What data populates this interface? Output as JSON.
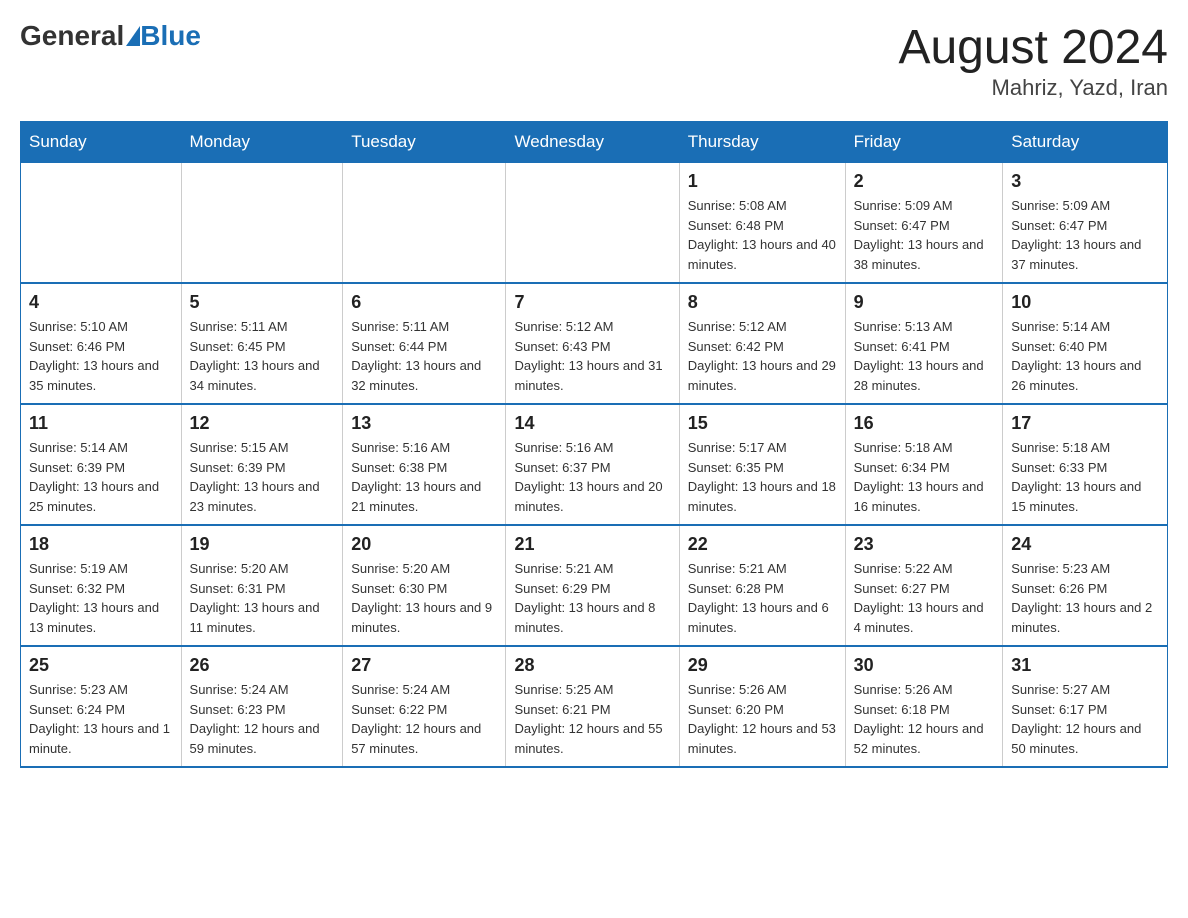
{
  "header": {
    "logo_general": "General",
    "logo_blue": "Blue",
    "month_year": "August 2024",
    "location": "Mahriz, Yazd, Iran"
  },
  "days_of_week": [
    "Sunday",
    "Monday",
    "Tuesday",
    "Wednesday",
    "Thursday",
    "Friday",
    "Saturday"
  ],
  "weeks": [
    [
      {
        "day": "",
        "info": ""
      },
      {
        "day": "",
        "info": ""
      },
      {
        "day": "",
        "info": ""
      },
      {
        "day": "",
        "info": ""
      },
      {
        "day": "1",
        "info": "Sunrise: 5:08 AM\nSunset: 6:48 PM\nDaylight: 13 hours and 40 minutes."
      },
      {
        "day": "2",
        "info": "Sunrise: 5:09 AM\nSunset: 6:47 PM\nDaylight: 13 hours and 38 minutes."
      },
      {
        "day": "3",
        "info": "Sunrise: 5:09 AM\nSunset: 6:47 PM\nDaylight: 13 hours and 37 minutes."
      }
    ],
    [
      {
        "day": "4",
        "info": "Sunrise: 5:10 AM\nSunset: 6:46 PM\nDaylight: 13 hours and 35 minutes."
      },
      {
        "day": "5",
        "info": "Sunrise: 5:11 AM\nSunset: 6:45 PM\nDaylight: 13 hours and 34 minutes."
      },
      {
        "day": "6",
        "info": "Sunrise: 5:11 AM\nSunset: 6:44 PM\nDaylight: 13 hours and 32 minutes."
      },
      {
        "day": "7",
        "info": "Sunrise: 5:12 AM\nSunset: 6:43 PM\nDaylight: 13 hours and 31 minutes."
      },
      {
        "day": "8",
        "info": "Sunrise: 5:12 AM\nSunset: 6:42 PM\nDaylight: 13 hours and 29 minutes."
      },
      {
        "day": "9",
        "info": "Sunrise: 5:13 AM\nSunset: 6:41 PM\nDaylight: 13 hours and 28 minutes."
      },
      {
        "day": "10",
        "info": "Sunrise: 5:14 AM\nSunset: 6:40 PM\nDaylight: 13 hours and 26 minutes."
      }
    ],
    [
      {
        "day": "11",
        "info": "Sunrise: 5:14 AM\nSunset: 6:39 PM\nDaylight: 13 hours and 25 minutes."
      },
      {
        "day": "12",
        "info": "Sunrise: 5:15 AM\nSunset: 6:39 PM\nDaylight: 13 hours and 23 minutes."
      },
      {
        "day": "13",
        "info": "Sunrise: 5:16 AM\nSunset: 6:38 PM\nDaylight: 13 hours and 21 minutes."
      },
      {
        "day": "14",
        "info": "Sunrise: 5:16 AM\nSunset: 6:37 PM\nDaylight: 13 hours and 20 minutes."
      },
      {
        "day": "15",
        "info": "Sunrise: 5:17 AM\nSunset: 6:35 PM\nDaylight: 13 hours and 18 minutes."
      },
      {
        "day": "16",
        "info": "Sunrise: 5:18 AM\nSunset: 6:34 PM\nDaylight: 13 hours and 16 minutes."
      },
      {
        "day": "17",
        "info": "Sunrise: 5:18 AM\nSunset: 6:33 PM\nDaylight: 13 hours and 15 minutes."
      }
    ],
    [
      {
        "day": "18",
        "info": "Sunrise: 5:19 AM\nSunset: 6:32 PM\nDaylight: 13 hours and 13 minutes."
      },
      {
        "day": "19",
        "info": "Sunrise: 5:20 AM\nSunset: 6:31 PM\nDaylight: 13 hours and 11 minutes."
      },
      {
        "day": "20",
        "info": "Sunrise: 5:20 AM\nSunset: 6:30 PM\nDaylight: 13 hours and 9 minutes."
      },
      {
        "day": "21",
        "info": "Sunrise: 5:21 AM\nSunset: 6:29 PM\nDaylight: 13 hours and 8 minutes."
      },
      {
        "day": "22",
        "info": "Sunrise: 5:21 AM\nSunset: 6:28 PM\nDaylight: 13 hours and 6 minutes."
      },
      {
        "day": "23",
        "info": "Sunrise: 5:22 AM\nSunset: 6:27 PM\nDaylight: 13 hours and 4 minutes."
      },
      {
        "day": "24",
        "info": "Sunrise: 5:23 AM\nSunset: 6:26 PM\nDaylight: 13 hours and 2 minutes."
      }
    ],
    [
      {
        "day": "25",
        "info": "Sunrise: 5:23 AM\nSunset: 6:24 PM\nDaylight: 13 hours and 1 minute."
      },
      {
        "day": "26",
        "info": "Sunrise: 5:24 AM\nSunset: 6:23 PM\nDaylight: 12 hours and 59 minutes."
      },
      {
        "day": "27",
        "info": "Sunrise: 5:24 AM\nSunset: 6:22 PM\nDaylight: 12 hours and 57 minutes."
      },
      {
        "day": "28",
        "info": "Sunrise: 5:25 AM\nSunset: 6:21 PM\nDaylight: 12 hours and 55 minutes."
      },
      {
        "day": "29",
        "info": "Sunrise: 5:26 AM\nSunset: 6:20 PM\nDaylight: 12 hours and 53 minutes."
      },
      {
        "day": "30",
        "info": "Sunrise: 5:26 AM\nSunset: 6:18 PM\nDaylight: 12 hours and 52 minutes."
      },
      {
        "day": "31",
        "info": "Sunrise: 5:27 AM\nSunset: 6:17 PM\nDaylight: 12 hours and 50 minutes."
      }
    ]
  ]
}
